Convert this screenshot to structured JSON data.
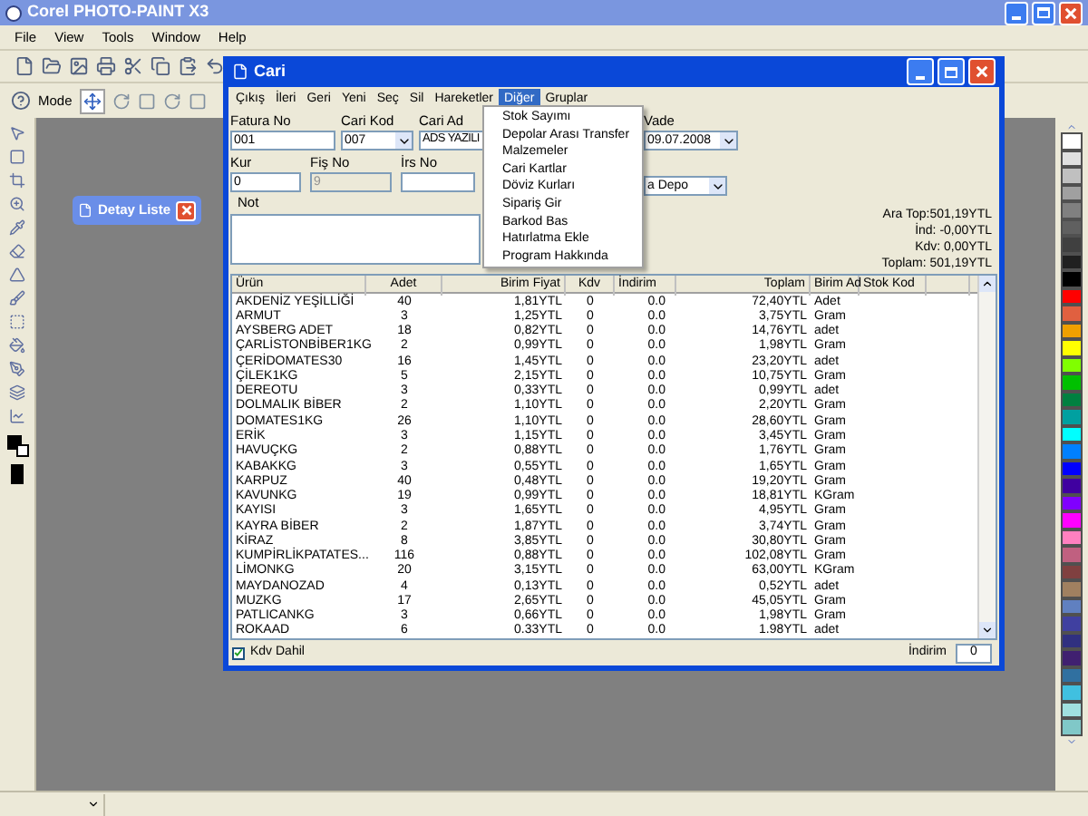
{
  "app_window": {
    "title": "Corel PHOTO-PAINT X3"
  },
  "menu_bar": [
    "File",
    "View",
    "Tools",
    "Window",
    "Help"
  ],
  "property_bar": {
    "mode_label": "Mode"
  },
  "minimized_window": {
    "title": "Detay Liste"
  },
  "cari_window": {
    "title": "Cari",
    "menu": [
      {
        "label": "Çıkış",
        "selected": false
      },
      {
        "label": "İleri",
        "selected": false
      },
      {
        "label": "Geri",
        "selected": false
      },
      {
        "label": "Yeni",
        "selected": false
      },
      {
        "label": "Seç",
        "selected": false
      },
      {
        "label": "Sil",
        "selected": false
      },
      {
        "label": "Hareketler",
        "selected": false
      },
      {
        "label": "Diğer",
        "selected": true
      },
      {
        "label": "Gruplar",
        "selected": false
      }
    ],
    "open_menu_items": [
      "Stok Sayımı",
      "Depolar Arası Transfer",
      "Malzemeler",
      "Cari Kartlar",
      "Döviz Kurları",
      "Sipariş Gir",
      "Barkod Bas",
      "Hatırlatma Ekle",
      "Program Hakkında"
    ],
    "form": {
      "fatura_no": {
        "label": "Fatura No",
        "value": "001"
      },
      "cari_kod": {
        "label": "Cari Kod",
        "value": "007"
      },
      "cari_ad": {
        "label": "Cari Ad",
        "value": "ADS YAZILI"
      },
      "vade": {
        "label": "Vade",
        "value": "09.07.2008"
      },
      "kur": {
        "label": "Kur",
        "value": "0"
      },
      "fis_no": {
        "label": "Fiş No",
        "value": "9",
        "disabled": true
      },
      "irs_no": {
        "label": "İrs No"
      },
      "depo": {
        "value": "a Depo"
      },
      "not": {
        "label": "Not"
      }
    },
    "totals": [
      "Ara Top:501,19YTL",
      "İnd: -0,00YTL",
      "Kdv: 0,00YTL",
      "Toplam: 501,19YTL"
    ],
    "table": {
      "columns": [
        "Ürün",
        "Adet",
        "Birim Fiyat",
        "Kdv",
        "İndirim",
        "Toplam",
        "Birim Ad",
        "Stok Kod"
      ],
      "rows": [
        [
          "AKDENİZ YEŞİLLİĞİ",
          "40",
          "1,81YTL",
          "0",
          "0.0",
          "72,40YTL",
          "Adet"
        ],
        [
          "ARMUT",
          "3",
          "1,25YTL",
          "0",
          "0.0",
          "3,75YTL",
          "Gram"
        ],
        [
          "AYSBERG ADET",
          "18",
          "0,82YTL",
          "0",
          "0.0",
          "14,76YTL",
          "adet"
        ],
        [
          "ÇARLİSTONBİBER1KG",
          "2",
          "0,99YTL",
          "0",
          "0.0",
          "1,98YTL",
          "Gram"
        ],
        [
          "ÇERİDOMATES30",
          "16",
          "1,45YTL",
          "0",
          "0.0",
          "23,20YTL",
          "adet"
        ],
        [
          "ÇİLEK1KG",
          "5",
          "2,15YTL",
          "0",
          "0.0",
          "10,75YTL",
          "Gram"
        ],
        [
          "DEREOTU",
          "3",
          "0,33YTL",
          "0",
          "0.0",
          "0,99YTL",
          "adet"
        ],
        [
          "DOLMALIK BİBER",
          "2",
          "1,10YTL",
          "0",
          "0.0",
          "2,20YTL",
          "Gram"
        ],
        [
          "DOMATES1KG",
          "26",
          "1,10YTL",
          "0",
          "0.0",
          "28,60YTL",
          "Gram"
        ],
        [
          "ERİK",
          "3",
          "1,15YTL",
          "0",
          "0.0",
          "3,45YTL",
          "Gram"
        ],
        [
          "HAVUÇKG",
          "2",
          "0,88YTL",
          "0",
          "0.0",
          "1,76YTL",
          "Gram"
        ],
        [
          "KABAKKG",
          "3",
          "0,55YTL",
          "0",
          "0.0",
          "1,65YTL",
          "Gram"
        ],
        [
          "KARPUZ",
          "40",
          "0,48YTL",
          "0",
          "0.0",
          "19,20YTL",
          "Gram"
        ],
        [
          "KAVUNKG",
          "19",
          "0,99YTL",
          "0",
          "0.0",
          "18,81YTL",
          "KGram"
        ],
        [
          "KAYISI",
          "3",
          "1,65YTL",
          "0",
          "0.0",
          "4,95YTL",
          "Gram"
        ],
        [
          "KAYRA BİBER",
          "2",
          "1,87YTL",
          "0",
          "0.0",
          "3,74YTL",
          "Gram"
        ],
        [
          "KİRAZ",
          "8",
          "3,85YTL",
          "0",
          "0.0",
          "30,80YTL",
          "Gram"
        ],
        [
          "KUMPİRLİKPATATES...",
          "116",
          "0,88YTL",
          "0",
          "0.0",
          "102,08YTL",
          "Gram"
        ],
        [
          "LİMONKG",
          "20",
          "3,15YTL",
          "0",
          "0.0",
          "63,00YTL",
          "KGram"
        ],
        [
          "MAYDANOZAD",
          "4",
          "0,13YTL",
          "0",
          "0.0",
          "0,52YTL",
          "adet"
        ],
        [
          "MUZKG",
          "17",
          "2,65YTL",
          "0",
          "0.0",
          "45,05YTL",
          "Gram"
        ],
        [
          "PATLICANKG",
          "3",
          "0,66YTL",
          "0",
          "0.0",
          "1,98YTL",
          "Gram"
        ],
        [
          "ROKAAD",
          "6",
          "0.33YTL",
          "0",
          "0.0",
          "1.98YTL",
          "adet"
        ]
      ]
    },
    "kdv_dahil": {
      "label": "Kdv Dahil",
      "checked": true
    },
    "indirim": {
      "label": "İndirim",
      "value": "0"
    }
  }
}
